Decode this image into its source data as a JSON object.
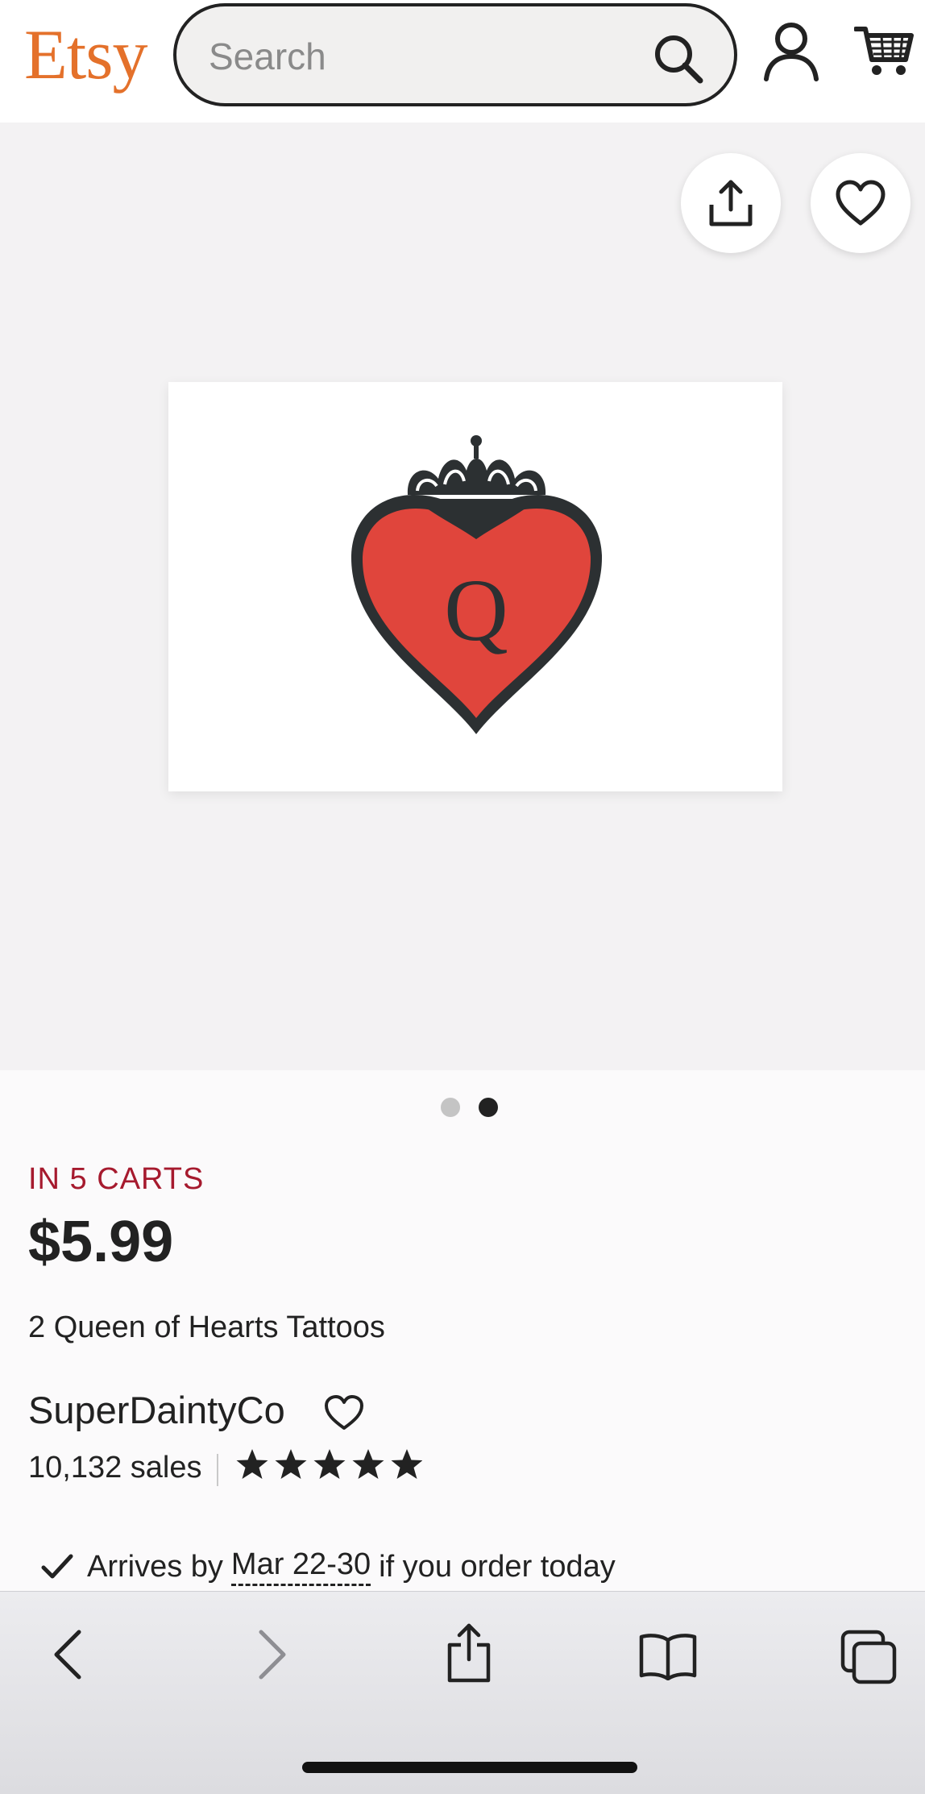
{
  "header": {
    "logo": "Etsy",
    "search_placeholder": "Search",
    "logo_color": "#e4712b"
  },
  "icons": {
    "search": "search-icon",
    "account": "user-icon",
    "cart": "cart-icon",
    "share": "share-icon",
    "favorite": "heart-icon"
  },
  "gallery": {
    "image_subject": "red heart with crown and letter Q",
    "image_letter": "Q",
    "image_count": 2,
    "active_image": 2
  },
  "listing": {
    "in_carts": "IN 5 CARTS",
    "price": "$5.99",
    "title": "2 Queen of Hearts Tattoos",
    "shop_name": "SuperDaintyCo",
    "sales": "10,132 sales",
    "rating_stars": 5,
    "arrives_prefix": "Arrives by",
    "arrives_date": "Mar 22-30",
    "arrives_suffix": "if you order today",
    "alert_color": "#a61a2e"
  },
  "browser": {
    "back": "chevron-left-icon",
    "forward": "chevron-right-icon",
    "share": "share-icon",
    "bookmarks": "book-icon",
    "tabs": "tabs-icon"
  }
}
